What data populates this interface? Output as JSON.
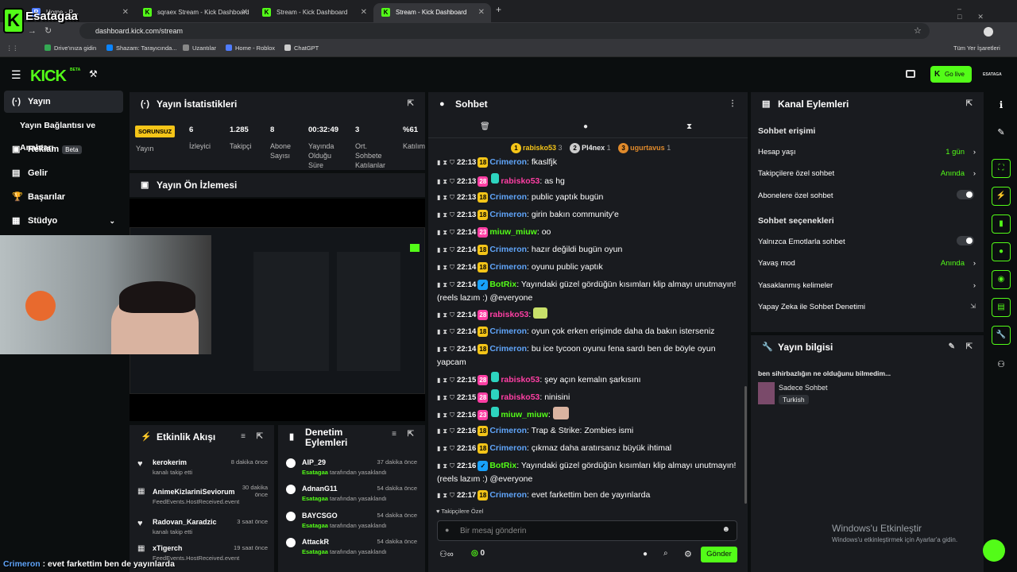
{
  "browser": {
    "tabs": [
      {
        "label": "Home - R..."
      },
      {
        "label": "sqraex Stream - Kick Dashboard"
      },
      {
        "label": "Stream - Kick Dashboard"
      },
      {
        "label": "Stream - Kick Dashboard"
      }
    ],
    "new_tab": "+",
    "url": "dashboard.kick.com/stream",
    "bookmarks": [
      "Drive'ınıza gidin",
      "Shazam: Tarayıcında...",
      "Uzantılar",
      "Home - Roblox",
      "ChatGPT"
    ],
    "all_bookmarks": "Tüm Yer İşaretleri"
  },
  "overlay": {
    "logo_text": "Esatagaa",
    "caption_user": "Crimeron",
    "caption_text": " : evet farkettim ben de yayınlarda"
  },
  "header": {
    "logo": "KICK",
    "beta": "BETA",
    "go_live": "Go live",
    "account": "ESATAGA"
  },
  "sidebar": {
    "items": [
      {
        "label": "Yayın",
        "icon": "(·)"
      },
      {
        "label": "Yayın Bağlantısı ve Anahtarı",
        "icon": ""
      },
      {
        "label": "Reklam",
        "icon": "▣",
        "badge": "Beta"
      },
      {
        "label": "Gelir",
        "icon": "▤"
      },
      {
        "label": "Başarılar",
        "icon": "🏆"
      },
      {
        "label": "Stüdyo",
        "icon": "▦"
      }
    ]
  },
  "stats": {
    "title": "Yayın İstatistikleri",
    "status": "SORUNSUZ",
    "status_label": "Yayın",
    "items": [
      {
        "value": "6",
        "label": "İzleyici"
      },
      {
        "value": "1.285",
        "label": "Takipçi"
      },
      {
        "value": "8",
        "label": "Abone Sayısı"
      },
      {
        "value": "00:32:49",
        "label": "Yayında Olduğu Süre"
      },
      {
        "value": "3",
        "label": "Ort. Sohbete Katılanlar"
      },
      {
        "value": "%61",
        "label": "Katılım"
      }
    ]
  },
  "preview": {
    "title": "Yayın Ön İzlemesi"
  },
  "activity": {
    "title": "Etkinlik Akışı",
    "items": [
      {
        "name": "kerokerim",
        "sub": "kanalı takip etti",
        "time": "8 dakika önce"
      },
      {
        "name": "AnimeKizlariniSeviorum",
        "sub": "FeedEvents.HostReceived.event",
        "time": "30 dakika önce"
      },
      {
        "name": "Radovan_Karadzic",
        "sub": "kanalı takip etti",
        "time": "3 saat önce"
      },
      {
        "name": "xTigerch",
        "sub": "FeedEvents.HostReceived.event",
        "time": "19 saat önce"
      }
    ]
  },
  "moderation": {
    "title": "Denetim Eylemleri",
    "by": "Esatagaa",
    "action": "tarafından yasaklandı",
    "items": [
      {
        "name": "AIP_29",
        "time": "37 dakika önce"
      },
      {
        "name": "AdnanG11",
        "time": "54 dakika önce"
      },
      {
        "name": "BAYCSGO",
        "time": "54 dakika önce"
      },
      {
        "name": "AttackR",
        "time": "54 dakika önce"
      }
    ]
  },
  "chat": {
    "title": "Sohbet",
    "top_chatters": [
      {
        "rank": "1",
        "name": "rabisko53",
        "count": "3"
      },
      {
        "rank": "2",
        "name": "Pl4nex",
        "count": "1"
      },
      {
        "rank": "3",
        "name": "ugurtavus",
        "count": "1"
      }
    ],
    "messages": [
      {
        "time": "22:13",
        "badge": "18",
        "user": "Crimeron",
        "text": ": fkaslfjk"
      },
      {
        "time": "22:13",
        "badge": "28",
        "user": "rabisko53",
        "text": ": as hg"
      },
      {
        "time": "22:13",
        "badge": "18",
        "user": "Crimeron",
        "text": ": public yaptık bugün"
      },
      {
        "time": "22:13",
        "badge": "18",
        "user": "Crimeron",
        "text": ": girin bakın community'e"
      },
      {
        "time": "22:14",
        "badge": "23",
        "user": "miuw_miuw",
        "text": ": oo"
      },
      {
        "time": "22:14",
        "badge": "18",
        "user": "Crimeron",
        "text": ": hazır değildi bugün oyun"
      },
      {
        "time": "22:14",
        "badge": "18",
        "user": "Crimeron",
        "text": ": oyunu public yaptık"
      },
      {
        "time": "22:14",
        "badge": "✓",
        "user": "BotRix",
        "text": ": Yayındaki güzel gördüğün kısımları klip almayı unutmayın! (reels lazım :) @everyone"
      },
      {
        "time": "22:14",
        "badge": "28",
        "user": "rabisko53",
        "text": ":"
      },
      {
        "time": "22:14",
        "badge": "18",
        "user": "Crimeron",
        "text": ": oyun çok erken erişimde daha da bakın isterseniz"
      },
      {
        "time": "22:14",
        "badge": "18",
        "user": "Crimeron",
        "text": ": bu ice tycoon oyunu fena sardı ben de böyle oyun yapcam"
      },
      {
        "time": "22:15",
        "badge": "28",
        "user": "rabisko53",
        "text": ": şey açın kemalın şarkısını"
      },
      {
        "time": "22:15",
        "badge": "28",
        "user": "rabisko53",
        "text": ": ninisini"
      },
      {
        "time": "22:16",
        "badge": "23",
        "user": "miuw_miuw",
        "text": ":"
      },
      {
        "time": "22:16",
        "badge": "18",
        "user": "Crimeron",
        "text": ": Trap & Strike: Zombies ismi"
      },
      {
        "time": "22:16",
        "badge": "18",
        "user": "Crimeron",
        "text": ": çıkmaz daha aratırsanız büyük ihtimal"
      },
      {
        "time": "22:16",
        "badge": "✓",
        "user": "BotRix",
        "text": ": Yayındaki güzel gördüğün kısımları klip almayı unutmayın! (reels lazım :) @everyone"
      },
      {
        "time": "22:17",
        "badge": "18",
        "user": "Crimeron",
        "text": ": evet farkettim ben de yayınlarda"
      }
    ],
    "followers_only": "Takipçilere Özel",
    "input_placeholder": "Bir mesaj gönderin",
    "points": "0",
    "send": "Gönder"
  },
  "channel_actions": {
    "title": "Kanal Eylemleri",
    "access_title": "Sohbet erişimi",
    "account_age": {
      "label": "Hesap yaşı",
      "value": "1 gün"
    },
    "followers_chat": {
      "label": "Takipçilere özel sohbet",
      "value": "Anında"
    },
    "subs_chat": {
      "label": "Abonelere özel sohbet"
    },
    "options_title": "Sohbet seçenekleri",
    "emotes_only": {
      "label": "Yalnızca Emotlarla sohbet"
    },
    "slow_mode": {
      "label": "Yavaş mod",
      "value": "Anında"
    },
    "banned_words": {
      "label": "Yasaklanmış kelimeler"
    },
    "ai_moderation": {
      "label": "Yapay Zeka ile Sohbet Denetimi"
    }
  },
  "stream_info": {
    "title": "Yayın bilgisi",
    "stream_title": "ben sihirbazlığın ne olduğunu bilmedim...",
    "category": "Sadece Sohbet",
    "tag": "Turkish"
  },
  "windows": {
    "title": "Windows'u Etkinleştir",
    "sub": "Windows'u etkinleştirmek için Ayarlar'a gidin."
  },
  "colors": {
    "accent": "#53fc18",
    "pink": "#ff3fa4",
    "gold": "#f5c518",
    "blue_user": "#60a5fa"
  }
}
